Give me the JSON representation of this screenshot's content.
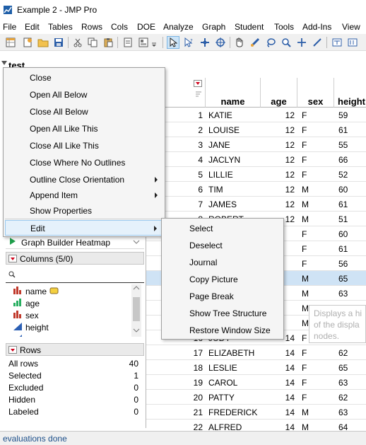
{
  "window": {
    "title": "Example 2 - JMP Pro"
  },
  "menubar": [
    "File",
    "Edit",
    "Tables",
    "Rows",
    "Cols",
    "DOE",
    "Analyze",
    "Graph",
    "Student",
    "Tools",
    "Add-Ins",
    "View"
  ],
  "outline": {
    "title": "test"
  },
  "table": {
    "columns": [
      "name",
      "age",
      "sex",
      "height"
    ],
    "rows": [
      {
        "n": "1",
        "name": "KATIE",
        "age": "12",
        "sex": "F",
        "height": "59"
      },
      {
        "n": "2",
        "name": "LOUISE",
        "age": "12",
        "sex": "F",
        "height": "61"
      },
      {
        "n": "3",
        "name": "JANE",
        "age": "12",
        "sex": "F",
        "height": "55"
      },
      {
        "n": "4",
        "name": "JACLYN",
        "age": "12",
        "sex": "F",
        "height": "66"
      },
      {
        "n": "5",
        "name": "LILLIE",
        "age": "12",
        "sex": "F",
        "height": "52"
      },
      {
        "n": "6",
        "name": "TIM",
        "age": "12",
        "sex": "M",
        "height": "60"
      },
      {
        "n": "7",
        "name": "JAMES",
        "age": "12",
        "sex": "M",
        "height": "61"
      },
      {
        "n": "8",
        "name": "ROBERT",
        "age": "12",
        "sex": "M",
        "height": "51"
      },
      {
        "n": "9",
        "name": "",
        "age": "",
        "sex": "F",
        "height": "60"
      },
      {
        "n": "10",
        "name": "",
        "age": "",
        "sex": "F",
        "height": "61"
      },
      {
        "n": "11",
        "name": "",
        "age": "",
        "sex": "F",
        "height": "56"
      },
      {
        "n": "12",
        "name": "",
        "age": "",
        "sex": "M",
        "height": "65"
      },
      {
        "n": "13",
        "name": "",
        "age": "",
        "sex": "M",
        "height": "63"
      },
      {
        "n": "14",
        "name": "",
        "age": "",
        "sex": "M",
        "height": "58"
      },
      {
        "n": "15",
        "name": "",
        "age": "",
        "sex": "M",
        "height": "59"
      },
      {
        "n": "16",
        "name": "JUDY",
        "age": "14",
        "sex": "F",
        "height": "61"
      },
      {
        "n": "17",
        "name": "ELIZABETH",
        "age": "14",
        "sex": "F",
        "height": "62"
      },
      {
        "n": "18",
        "name": "LESLIE",
        "age": "14",
        "sex": "F",
        "height": "65"
      },
      {
        "n": "19",
        "name": "CAROL",
        "age": "14",
        "sex": "F",
        "height": "63"
      },
      {
        "n": "20",
        "name": "PATTY",
        "age": "14",
        "sex": "F",
        "height": "62"
      },
      {
        "n": "21",
        "name": "FREDERICK",
        "age": "14",
        "sex": "M",
        "height": "63"
      },
      {
        "n": "22",
        "name": "ALFRED",
        "age": "14",
        "sex": "M",
        "height": "64"
      }
    ],
    "selected_row": 12
  },
  "left": {
    "script_item": "Graph Builder Heatmap",
    "columns_header": "Columns (5/0)",
    "column_items": [
      {
        "name": "name",
        "icon": "nominal-icon",
        "color": "#c0392b"
      },
      {
        "name": "age",
        "icon": "ordinal-icon",
        "color": "#27ae60"
      },
      {
        "name": "sex",
        "icon": "nominal-icon",
        "color": "#c0392b"
      },
      {
        "name": "height",
        "icon": "continuous-icon",
        "color": "#2b5fb4"
      }
    ],
    "rows_header": "Rows",
    "row_stats": [
      {
        "label": "All rows",
        "value": "40"
      },
      {
        "label": "Selected",
        "value": "1"
      },
      {
        "label": "Excluded",
        "value": "0"
      },
      {
        "label": "Hidden",
        "value": "0"
      },
      {
        "label": "Labeled",
        "value": "0"
      }
    ]
  },
  "context_menu": {
    "items": [
      "Close",
      "Open All Below",
      "Close All Below",
      "Open All Like This",
      "Close All Like This",
      "Close Where No Outlines",
      "Outline Close Orientation",
      "Append Item",
      "Show Properties",
      "Edit"
    ],
    "submenu_items": [
      "Select",
      "Deselect",
      "Journal",
      "Copy Picture",
      "Page Break",
      "Show Tree Structure",
      "Restore Window Size"
    ]
  },
  "tooltip": {
    "line1": "Displays a hi",
    "line2": "of the displa",
    "line3": "nodes."
  },
  "status": {
    "text": "evaluations done"
  },
  "colors": {
    "accent_red": "#d0021b",
    "selection_blue": "#cfe3f5",
    "menu_highlight": "#e5f1fb"
  }
}
